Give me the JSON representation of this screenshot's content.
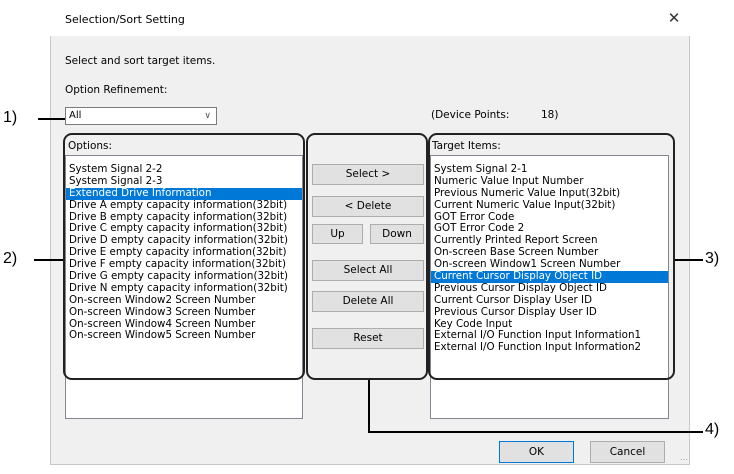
{
  "window": {
    "title": "Selection/Sort Setting",
    "close_glyph": "✕"
  },
  "instruction": "Select and sort target items.",
  "option_refinement": {
    "label": "Option Refinement:",
    "selected": "All"
  },
  "device_points": {
    "label": "(Device Points:",
    "value": "18)"
  },
  "options": {
    "label": "Options:",
    "items": [
      "System Signal 2-2",
      "System Signal 2-3",
      "Extended Drive Information",
      "Drive A empty capacity information(32bit)",
      "Drive B empty capacity information(32bit)",
      "Drive C empty capacity information(32bit)",
      "Drive D empty capacity information(32bit)",
      "Drive E empty capacity information(32bit)",
      "Drive F empty capacity information(32bit)",
      "Drive G empty capacity information(32bit)",
      "Drive N empty capacity information(32bit)",
      "On-screen Window2 Screen Number",
      "On-screen Window3 Screen Number",
      "On-screen Window4 Screen Number",
      "On-screen Window5 Screen Number"
    ],
    "selected_index": 2
  },
  "target": {
    "label": "Target Items:",
    "items": [
      "System Signal 2-1",
      "Numeric Value Input Number",
      "Previous Numeric Value Input(32bit)",
      "Current Numeric Value Input(32bit)",
      "GOT Error Code",
      "GOT Error Code 2",
      "Currently Printed Report Screen",
      "On-screen Base Screen Number",
      "On-screen Window1 Screen Number",
      "Current Cursor Display Object ID",
      "Previous Cursor Display Object ID",
      "Current Cursor Display User ID",
      "Previous Cursor Display User ID",
      "Key Code Input",
      "External I/O Function Input Information1",
      "External I/O Function Input Information2"
    ],
    "selected_index": 9
  },
  "buttons": {
    "select": "Select >",
    "delete": "< Delete",
    "up": "Up",
    "down": "Down",
    "select_all": "Select All",
    "delete_all": "Delete All",
    "reset": "Reset",
    "ok": "OK",
    "cancel": "Cancel"
  },
  "callouts": {
    "c1": "1)",
    "c2": "2)",
    "c3": "3)",
    "c4": "4)"
  },
  "colors": {
    "selection": "#0078d7",
    "dialog_bg": "#f0f0f0"
  }
}
